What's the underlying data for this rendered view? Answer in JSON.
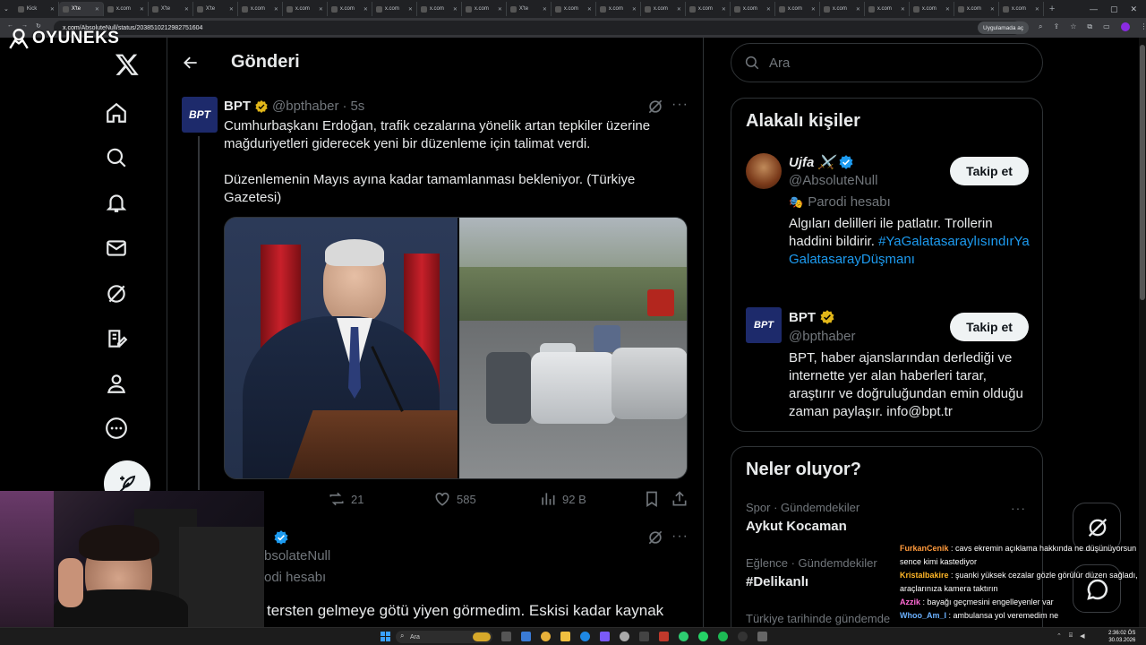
{
  "browser": {
    "tabs": [
      "Kick",
      "X'te",
      "x.com",
      "X'te",
      "X'te",
      "x.com",
      "x.com",
      "x.com",
      "x.com",
      "x.com",
      "x.com",
      "X'te",
      "x.com",
      "x.com",
      "x.com",
      "x.com",
      "x.com",
      "x.com",
      "x.com",
      "x.com",
      "x.com",
      "x.com",
      "x.com"
    ],
    "url_host": "x.com",
    "url_path": "/AbsoluteNull/status/2038510212982751604",
    "open_in_app": "Uygulamada aç"
  },
  "watermark": {
    "text": "OYUNEKS"
  },
  "page": {
    "header_title": "Gönderi"
  },
  "tweet": {
    "avatar_text": "BPT",
    "name": "BPT",
    "handle": "@bpthaber",
    "separator": "·",
    "time": "5s",
    "text1": "Cumhurbaşkanı Erdoğan, trafik cezalarına yönelik artan tepkiler üzerine mağduriyetleri giderecek yeni bir düzenleme için talimat verdi.",
    "text2": "Düzenlemenin Mayıs ayına kadar tamamlanması bekleniyor. (Türkiye Gazetesi)",
    "retweets": "21",
    "likes": "585",
    "views": "92 B"
  },
  "reply": {
    "name_visible": "",
    "handle_visible": "bsolateNull",
    "parody_visible": "odi hesabı",
    "text_visible": "tersten gelmeye götü yiyen görmedim. Eskisi kadar kaynak"
  },
  "search": {
    "placeholder": "Ara"
  },
  "related": {
    "title": "Alakalı kişiler",
    "people": [
      {
        "name": "Ujfa ⚔️",
        "handle": "@AbsoluteNull",
        "parody": "Parodi hesabı",
        "bio": "Algıları delilleri ile patlatır. Trollerin haddini bildirir.",
        "hashtag": "#YaGalatasaraylısındırYaGalatasarayDüşmanı",
        "follow": "Takip et"
      },
      {
        "name": "BPT",
        "handle": "@bpthaber",
        "avatar_text": "BPT",
        "bio": "BPT, haber ajanslarından derlediği ve internette yer alan haberleri tarar, araştırır ve doğruluğundan emin olduğu zaman paylaşır. info@bpt.tr",
        "follow": "Takip et"
      }
    ]
  },
  "trends": {
    "title": "Neler oluyor?",
    "items": [
      {
        "category": "Spor · Gündemdekiler",
        "name": "Aykut Kocaman"
      },
      {
        "category": "Eğlence · Gündemdekiler",
        "name": "#Delikanlı"
      },
      {
        "category": "Türkiye tarihinde gündemde",
        "name": ""
      }
    ]
  },
  "chat": [
    {
      "user": "FurkanCenik",
      "color": "#ff9a3c",
      "msg": "cavs ekremin açıklama hakkında ne düşünüyorsun sence kimi kastediyor"
    },
    {
      "user": "Kristalbakire",
      "color": "#ffb627",
      "msg": "şuanki yüksek cezalar gözle görülür düzen sağladı, araçlarınıza kamera taktırın"
    },
    {
      "user": "Azzik",
      "color": "#ff6ad5",
      "msg": "bayağı geçmesini engelleyenler var"
    },
    {
      "user": "Whoo_Am_I",
      "color": "#6ab0ff",
      "msg": "ambulansa yol veremedim ne"
    }
  ],
  "taskbar": {
    "search": "Ara",
    "time": "2:36:02 ÖS",
    "date": "30.03.2026"
  },
  "colors": {
    "accent": "#1d9bf0",
    "gold": "#e2b719",
    "bg": "#000000",
    "border": "#2f3336",
    "muted": "#71767b"
  }
}
